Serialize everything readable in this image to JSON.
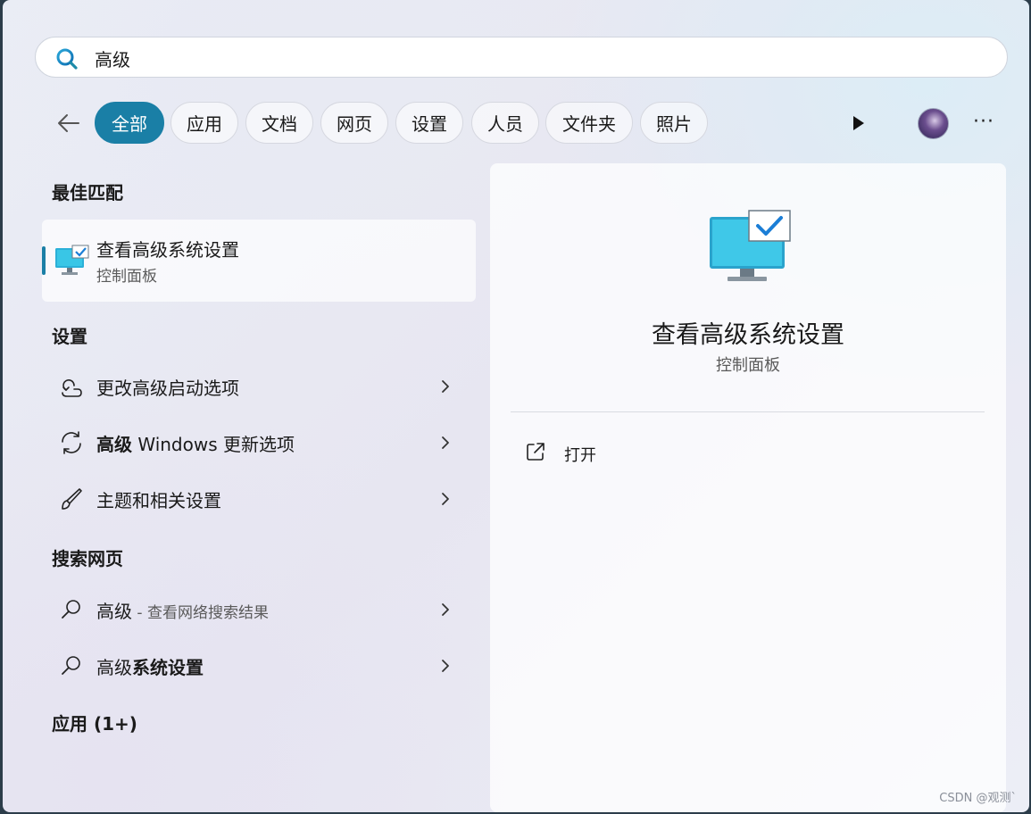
{
  "search": {
    "value": "高级"
  },
  "filters": [
    "全部",
    "应用",
    "文档",
    "网页",
    "设置",
    "人员",
    "文件夹",
    "照片"
  ],
  "sections": {
    "best_match": "最佳匹配",
    "settings": "设置",
    "web": "搜索网页",
    "apps": "应用 (1+)"
  },
  "best_match": {
    "title": "查看高级系统设置",
    "subtitle": "控制面板"
  },
  "settings_items": [
    {
      "label": "更改高级启动选项"
    },
    {
      "bold": "高级",
      "rest": " Windows 更新选项"
    },
    {
      "label": "主题和相关设置"
    }
  ],
  "web_items": [
    {
      "label": "高级",
      "hint": " - 查看网络搜索结果"
    },
    {
      "normal": "高级",
      "bold": "系统设置"
    }
  ],
  "preview": {
    "title": "查看高级系统设置",
    "subtitle": "控制面板",
    "open_label": "打开"
  },
  "colors": {
    "accent": "#1a7fa6"
  },
  "watermark": "CSDN @观测`"
}
